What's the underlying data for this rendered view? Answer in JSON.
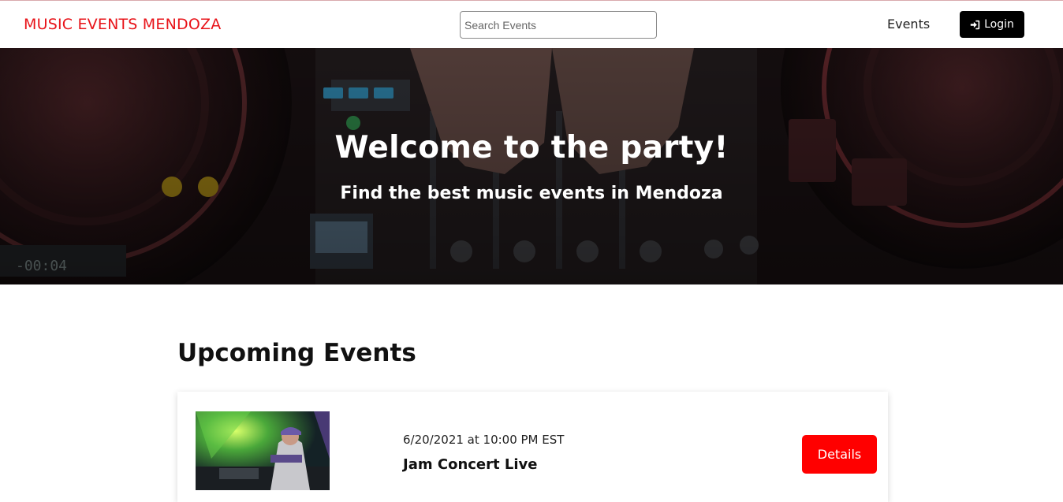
{
  "navbar": {
    "brand": "MUSIC EVENTS MENDOZA",
    "search_placeholder": "Search Events",
    "events_link": "Events",
    "login_label": "Login"
  },
  "hero": {
    "title": "Welcome to the party!",
    "subtitle": "Find the best music events in Mendoza"
  },
  "events_section": {
    "title": "Upcoming Events",
    "items": [
      {
        "datetime": "6/20/2021 at 10:00 PM EST",
        "name": "Jam Concert Live",
        "details_label": "Details"
      }
    ]
  },
  "colors": {
    "brand": "#e8141a",
    "login_bg": "#000000",
    "details_bg": "#ff0000"
  }
}
